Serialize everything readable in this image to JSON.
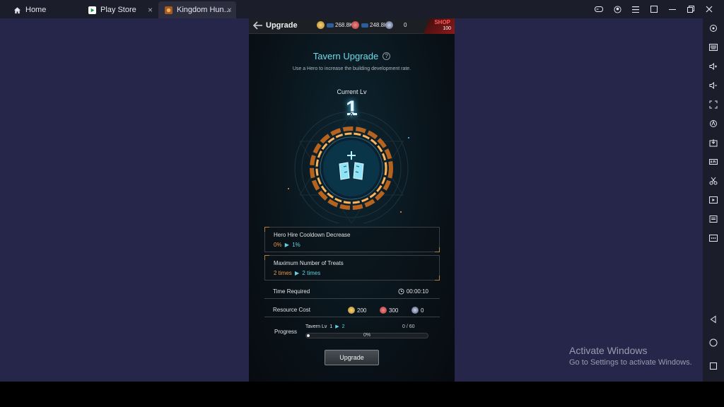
{
  "browser": {
    "tabs": [
      {
        "label": "Home",
        "icon": "home-icon"
      },
      {
        "label": "Play Store",
        "icon": "play-store-icon"
      },
      {
        "label": "Kingdom Hun...",
        "icon": "game-icon"
      }
    ],
    "close_glyph": "×"
  },
  "game": {
    "title": "Upgrade",
    "resources": {
      "gold": "268.8K",
      "meat": "248.8K",
      "ore": "0"
    },
    "shop": {
      "label": "SHOP",
      "gems": "100"
    },
    "heading": "Tavern Upgrade",
    "subtitle": "Use a Hero to increase the building development rate.",
    "current_lv_label": "Current Lv",
    "current_lv": "1",
    "cards": [
      {
        "title": "Hero Hire Cooldown Decrease",
        "from": "0%",
        "to": "1%"
      },
      {
        "title": "Maximum Number of Treats",
        "from": "2 times",
        "to": "2 times"
      }
    ],
    "time_required": {
      "label": "Time Required",
      "value": "00:00:10"
    },
    "resource_cost": {
      "label": "Resource Cost",
      "gold": "200",
      "meat": "300",
      "ore": "0"
    },
    "progress": {
      "label": "Progress",
      "building": "Tavern Lv",
      "from": "1",
      "to": "2",
      "count": "0 / 60",
      "percent_text": "0%",
      "value": 0
    },
    "upgrade_button": "Upgrade"
  },
  "watermark": {
    "line1": "Activate Windows",
    "line2": "Go to Settings to activate Windows."
  },
  "colors": {
    "accent": "#6fdcea",
    "orange": "#e69a47",
    "background": "#26264a"
  }
}
